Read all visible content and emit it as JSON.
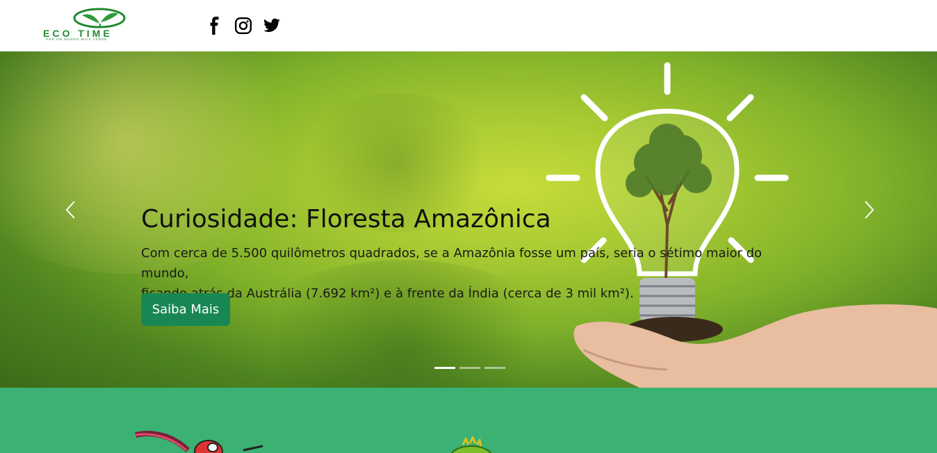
{
  "navbar": {
    "logo": {
      "title": "ECO TIME",
      "tagline": "POR UM MUNDO MAIS VERDE"
    },
    "social": [
      {
        "icon": "facebook-icon"
      },
      {
        "icon": "instagram-icon"
      },
      {
        "icon": "twitter-icon"
      }
    ]
  },
  "carousel": {
    "title": "Curiosidade: Floresta Amazônica",
    "text_line1": "Com cerca de 5.500 quilômetros quadrados, se a Amazônia fosse um país, seria o sétimo maior do mundo,",
    "text_line2": "ficando atrás da Austrália (7.692 km²) e à frente da Índia (cerca de 3 mil km²).",
    "button_label": "Saiba Mais",
    "prev_icon": "chevron-left-icon",
    "next_icon": "chevron-right-icon",
    "indicators": [
      {
        "active": true
      },
      {
        "active": false
      },
      {
        "active": false
      }
    ],
    "image_icon": "lightbulb-tree-icon"
  },
  "colors": {
    "primary_button": "#198754",
    "section_green": "#3bb273",
    "logo_green": "#1f8a2f"
  }
}
